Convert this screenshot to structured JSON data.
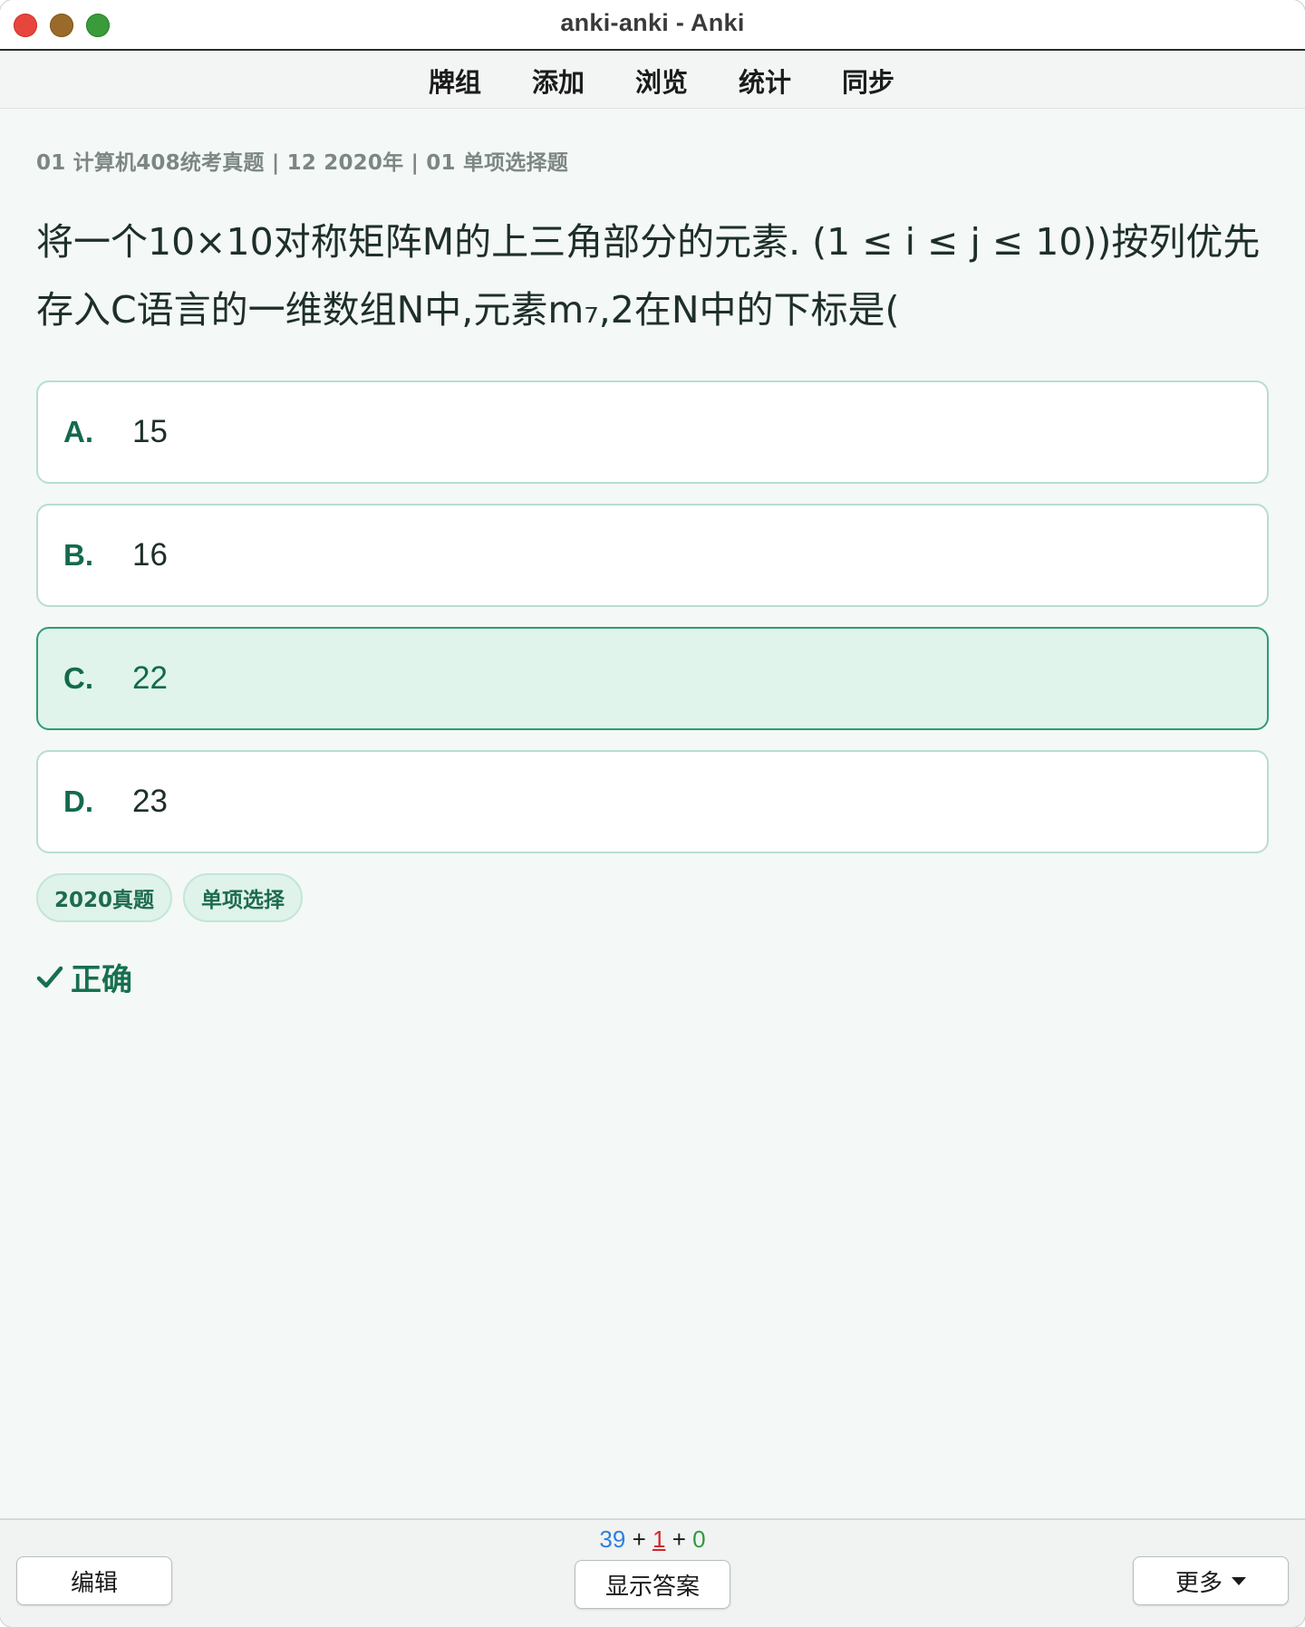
{
  "window": {
    "title": "anki-anki - Anki"
  },
  "nav": {
    "items": [
      "牌组",
      "添加",
      "浏览",
      "统计",
      "同步"
    ]
  },
  "card": {
    "breadcrumb": "01 计算机408统考真题 | 12 2020年 | 01 单项选择题",
    "question": "将一个10×10对称矩阵M的上三角部分的元素. (1 ≤ i ≤ j ≤ 10))按列优先存入C语言的一维数组N中,元素m₇,2在N中的下标是(",
    "options": [
      {
        "letter": "A.",
        "text": "15",
        "selected": false
      },
      {
        "letter": "B.",
        "text": "16",
        "selected": false
      },
      {
        "letter": "C.",
        "text": "22",
        "selected": true
      },
      {
        "letter": "D.",
        "text": "23",
        "selected": false
      }
    ],
    "tags": [
      "2020真题",
      "单项选择"
    ],
    "result": "正确"
  },
  "bottombar": {
    "edit_label": "编辑",
    "show_answer_label": "显示答案",
    "more_label": "更多",
    "counts": {
      "new": "39",
      "plus1": "+",
      "learn": "1",
      "plus2": "+",
      "review": "0"
    }
  },
  "colors": {
    "accent": "#136a4c",
    "selected_bg": "#e0f4ec",
    "new_count": "#2e7fe0",
    "learn_count": "#d2262d",
    "review_count": "#2e9a3e"
  }
}
